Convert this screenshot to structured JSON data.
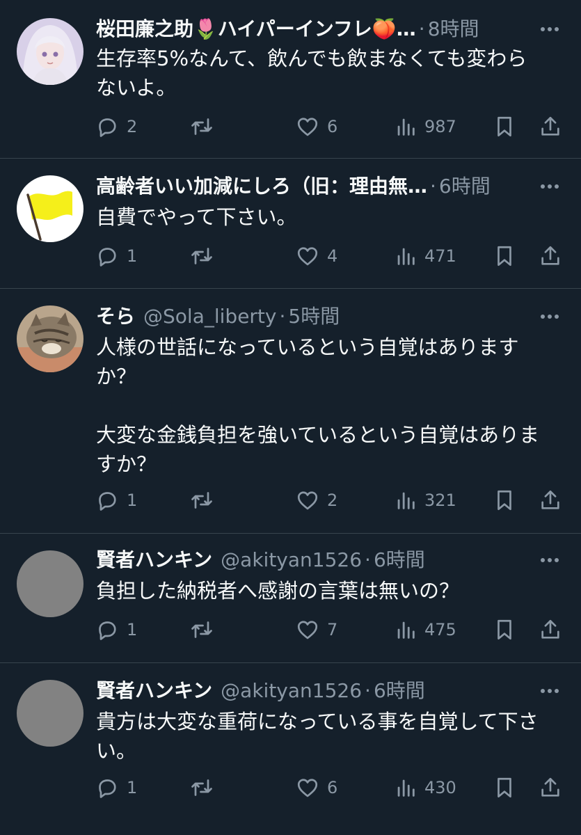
{
  "tweets": [
    {
      "name": "桜田廉之助🌷ハイパーインフレ🍑…",
      "handle": "",
      "time": "8時間",
      "text": "生存率5%なんて、飲んでも飲まなくても変わら\nないよ。",
      "replies": "2",
      "retweets": "",
      "likes": "6",
      "views": "987",
      "avatar": "anime-girl"
    },
    {
      "name": "高齢者いい加減にしろ（旧：理由無…",
      "handle": "",
      "time": "6時間",
      "text": "自費でやって下さい。",
      "replies": "1",
      "retweets": "",
      "likes": "4",
      "views": "471",
      "avatar": "yellow-flag"
    },
    {
      "name": "そら",
      "handle": "@Sola_liberty",
      "time": "5時間",
      "text": "人様の世話になっているという自覚はあります\nか？\n\n大変な金銭負担を強いているという自覚はありま\nすか？",
      "replies": "1",
      "retweets": "",
      "likes": "2",
      "views": "321",
      "avatar": "cat"
    },
    {
      "name": "賢者ハンキン",
      "handle": "@akityan1526",
      "time": "6時間",
      "text": "負担した納税者へ感謝の言葉は無いの？",
      "replies": "1",
      "retweets": "",
      "likes": "7",
      "views": "475",
      "avatar": "default-gray"
    },
    {
      "name": "賢者ハンキン",
      "handle": "@akityan1526",
      "time": "6時間",
      "text": "貴方は大変な重荷になっている事を自覚して下さ\nい。",
      "replies": "1",
      "retweets": "",
      "likes": "6",
      "views": "430",
      "avatar": "default-gray"
    }
  ],
  "separator": "·",
  "icons": {
    "reply": "reply-icon",
    "retweet": "retweet-icon",
    "like": "like-icon",
    "views": "views-icon",
    "bookmark": "bookmark-icon",
    "share": "share-icon",
    "more": "more-icon"
  },
  "colors": {
    "background": "#15202b",
    "text": "#f7f9f9",
    "muted": "#8b98a5",
    "divider": "#38444d"
  }
}
